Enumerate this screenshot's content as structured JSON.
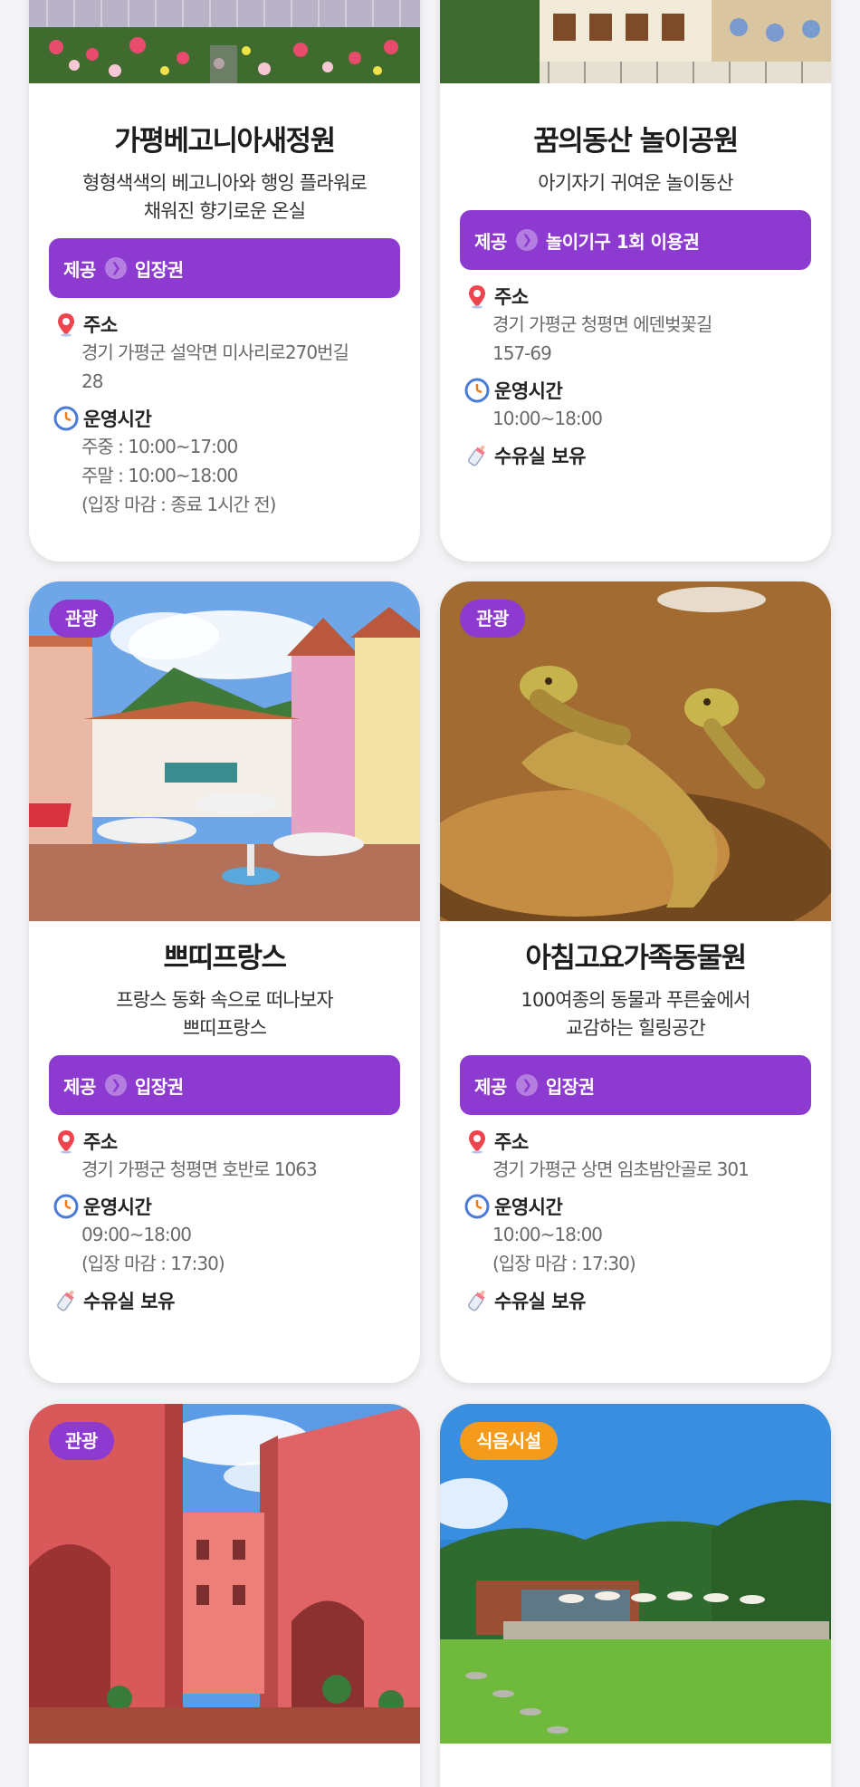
{
  "labels": {
    "provide": "제공",
    "address": "주소",
    "hours": "운영시간",
    "nursing": "수유실 보유"
  },
  "colors": {
    "accent": "#8d3ad0",
    "food_badge": "#f59b1c"
  },
  "cards": [
    {
      "title": "가평베고니아새정원",
      "desc": [
        "형형색색의 베고니아와 행잉 플라워로",
        "채워진 향기로운 온실"
      ],
      "provide": "입장권",
      "address": [
        "경기 가평군 설악면 미사리로270번길",
        "28"
      ],
      "hours": [
        "주중 : 10:00~17:00",
        "주말 : 10:00~18:00",
        "(입장 마감 : 종료 1시간 전)"
      ]
    },
    {
      "title": "꿈의동산 놀이공원",
      "desc": [
        "아기자기 귀여운 놀이동산"
      ],
      "provide": "놀이기구 1회 이용권",
      "address": [
        "경기 가평군 청평면 에덴벚꽃길",
        "157-69"
      ],
      "hours": [
        "10:00~18:00"
      ]
    },
    {
      "badge": "관광",
      "title": "쁘띠프랑스",
      "desc": [
        "프랑스 동화 속으로 떠나보자",
        "쁘띠프랑스"
      ],
      "provide": "입장권",
      "address": [
        "경기 가평군 청평면 호반로 1063"
      ],
      "hours": [
        "09:00~18:00",
        "(입장 마감 : 17:30)"
      ]
    },
    {
      "badge": "관광",
      "title": "아침고요가족동물원",
      "desc": [
        "100여종의 동물과 푸른숲에서",
        "교감하는 힐링공간"
      ],
      "provide": "입장권",
      "address": [
        "경기 가평군 상면 임초밤안골로 301"
      ],
      "hours": [
        "10:00~18:00",
        "(입장 마감 : 17:30)"
      ]
    },
    {
      "badge": "관광"
    },
    {
      "badge": "식음시설"
    }
  ]
}
